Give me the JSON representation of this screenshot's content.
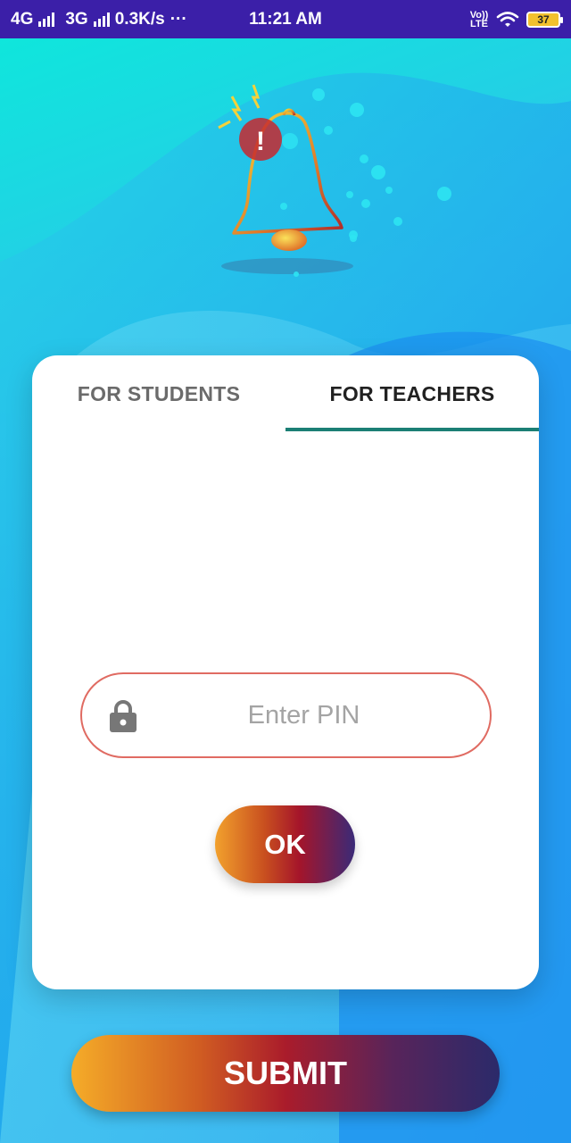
{
  "status_bar": {
    "network_left": "4G",
    "network_right": "3G",
    "speed": "0.3K/s",
    "more": "···",
    "time": "11:21 AM",
    "volte": "Vo)) LTE",
    "battery": "37"
  },
  "tabs": [
    {
      "label": "FOR STUDENTS",
      "active": false
    },
    {
      "label": "FOR TEACHERS",
      "active": true
    }
  ],
  "pin": {
    "placeholder": "Enter PIN",
    "value": ""
  },
  "buttons": {
    "ok": "OK",
    "submit": "SUBMIT"
  },
  "colors": {
    "status_bar": "#3b1fa8",
    "tab_indicator": "#1b7f75",
    "pin_border": "#e06b62",
    "gradient_start": "#f5ac28",
    "gradient_mid": "#aa1c2b",
    "gradient_end": "#2b2a6a"
  },
  "icons": [
    "signal-icon",
    "wifi-icon",
    "battery-icon",
    "bell-alert-icon",
    "lock-icon"
  ]
}
